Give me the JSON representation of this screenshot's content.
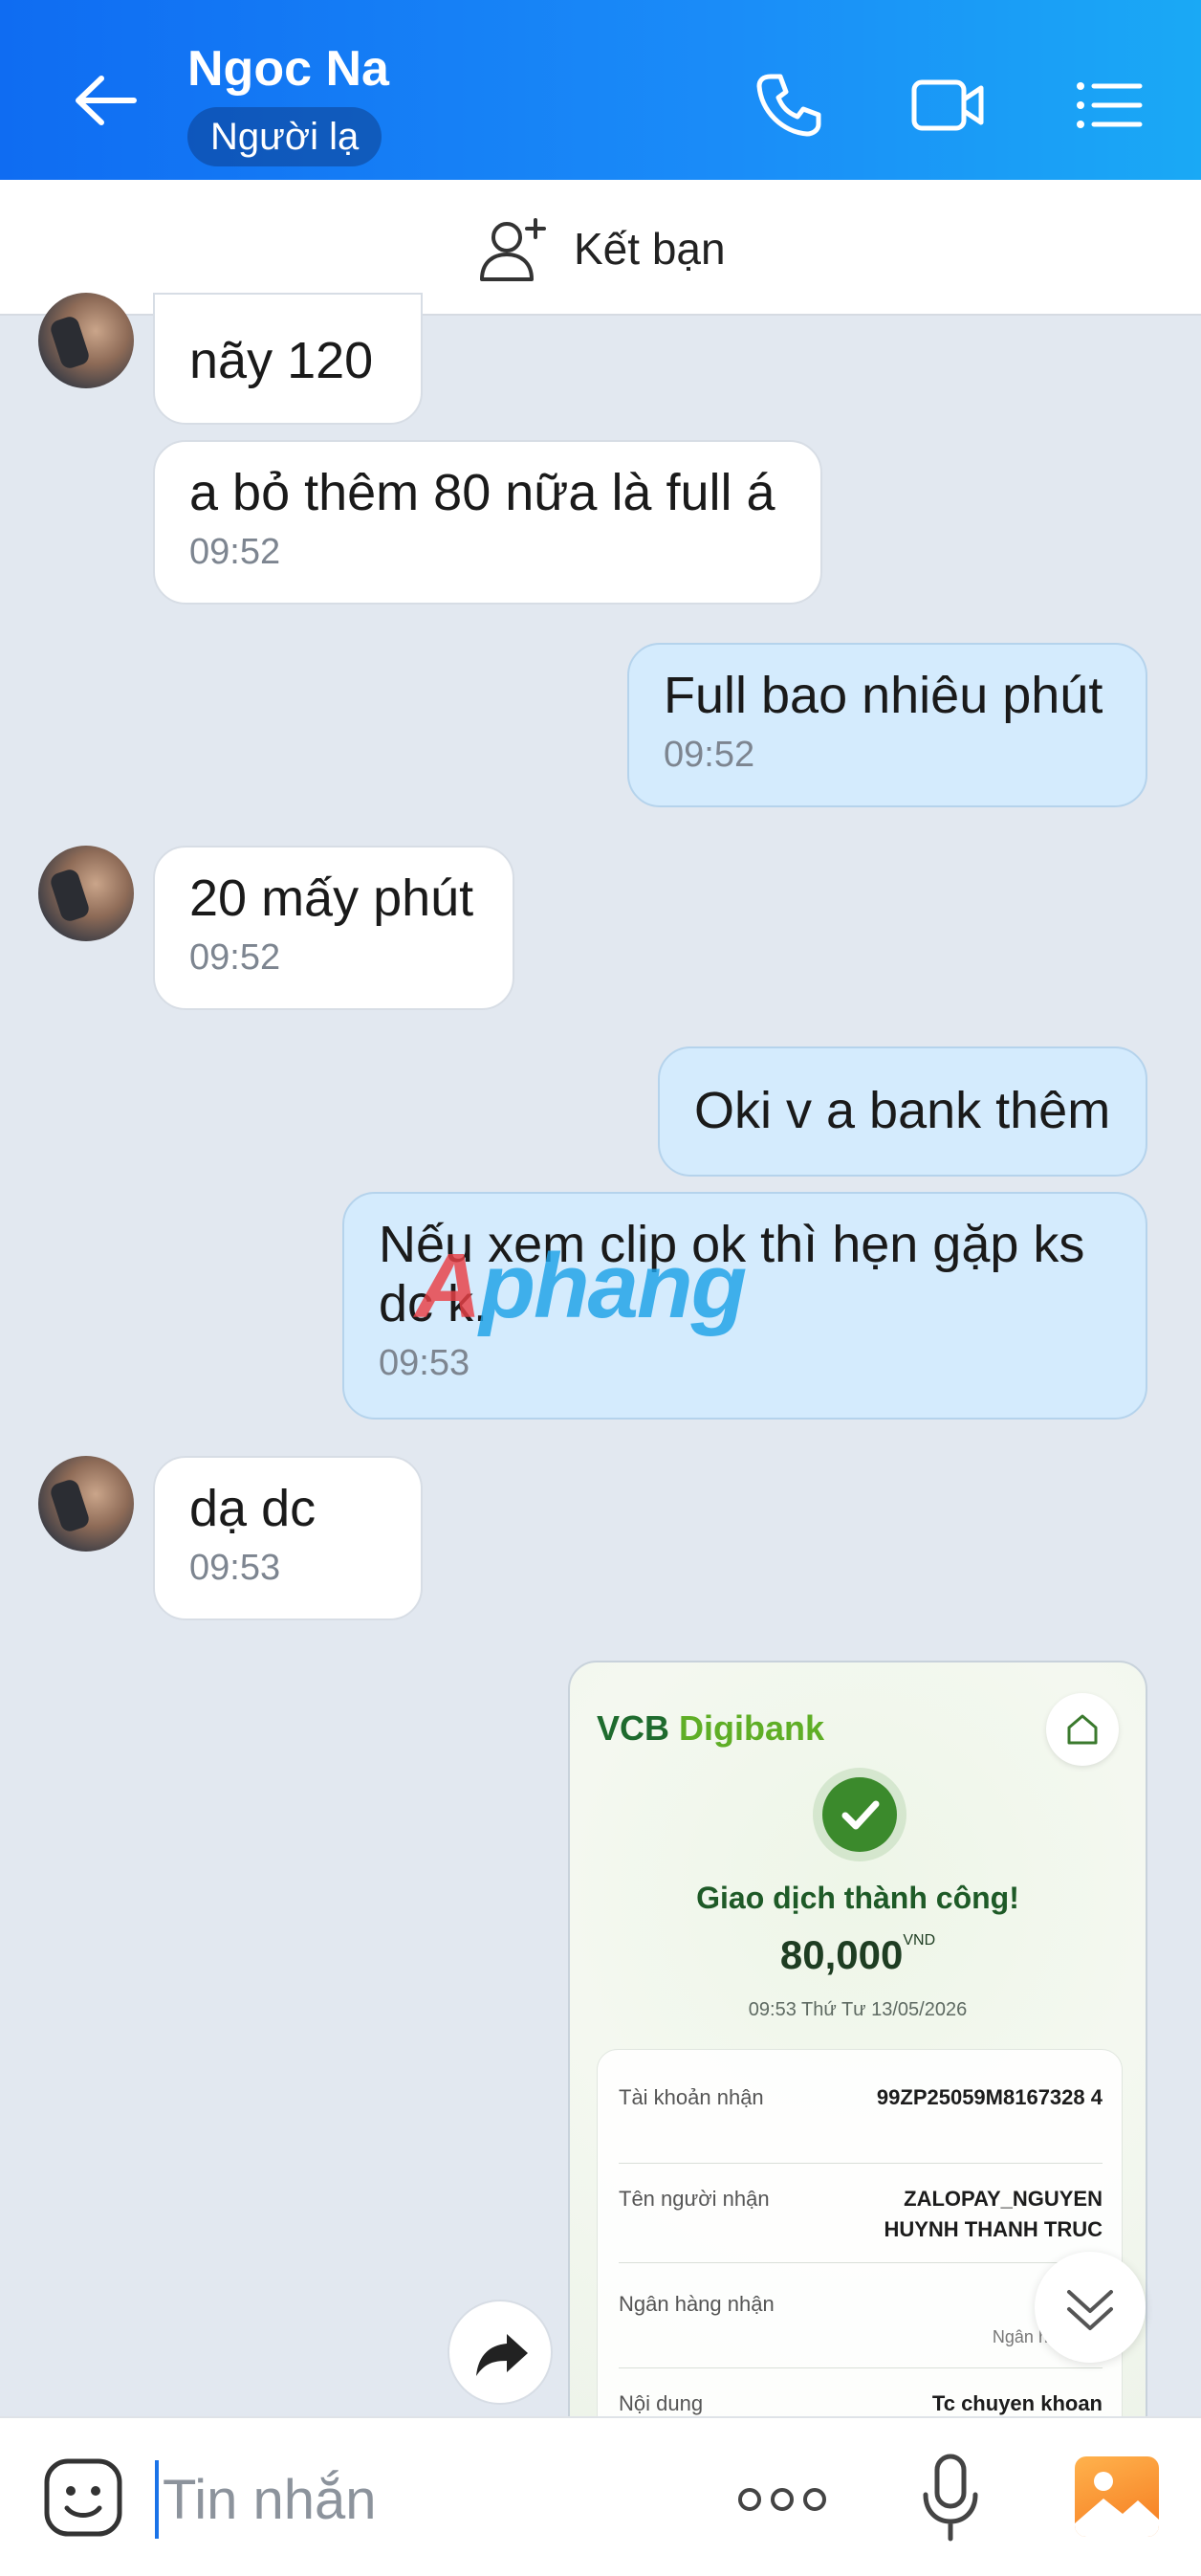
{
  "header": {
    "contact_name": "Ngoc Na",
    "contact_badge": "Người lạ",
    "background": "#1a8cf8"
  },
  "add_friend": {
    "label": "Kết bạn"
  },
  "messages": [
    {
      "side": "in",
      "text": "nãy 120",
      "time": ""
    },
    {
      "side": "in",
      "text": "a bỏ thêm 80 nữa là full á",
      "time": "09:52"
    },
    {
      "side": "out",
      "text": "Full bao nhiêu phút",
      "time": "09:52"
    },
    {
      "side": "in",
      "text": "20 mấy phút",
      "time": "09:52"
    },
    {
      "side": "out",
      "text": "Oki v a bank thêm",
      "time": ""
    },
    {
      "side": "out",
      "text": "Nếu xem clip ok thì hẹn gặp ks dc k.",
      "time": "09:53"
    },
    {
      "side": "in",
      "text": "dạ dc",
      "time": "09:53"
    }
  ],
  "receipt": {
    "logo_a": "VCB",
    "logo_b": "Digibank",
    "status": "Giao dịch thành công!",
    "amount": "80,000",
    "currency": "VND",
    "datetime": "09:53 Thứ Tư 13/05/2026",
    "rows": [
      {
        "label": "Tài khoản nhận",
        "value": "99ZP25059M8167328 4"
      },
      {
        "label": "Tên người nhận",
        "value": "ZALOPAY_NGUYEN HUYNH THANH TRUC"
      },
      {
        "label": "Ngân hàng nhận",
        "value": "Ngân hàng Ba"
      },
      {
        "label": "Nội dung",
        "value": "Tc chuyen khoan"
      }
    ]
  },
  "watermark": {
    "part_a": "A",
    "part_b": "phang"
  },
  "input": {
    "placeholder": "Tin nhắn"
  },
  "colors": {
    "accent": "#1a8cf8",
    "incoming": "#ffffff",
    "outgoing": "#d4ebfd",
    "success": "#3b8a2c"
  }
}
